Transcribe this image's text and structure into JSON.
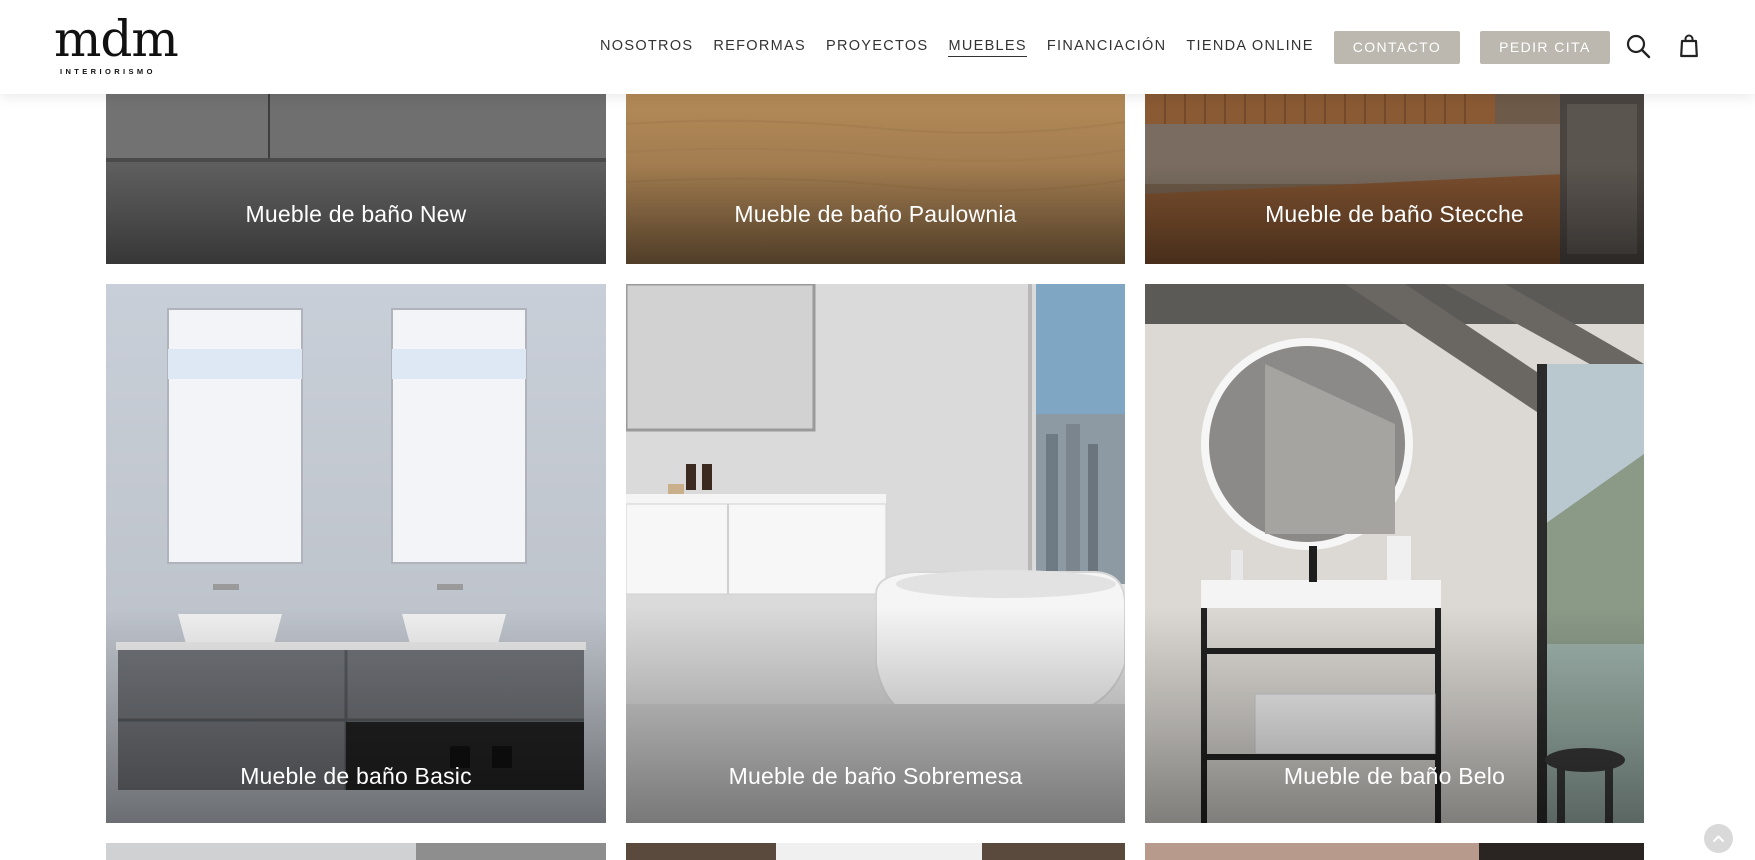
{
  "brand": {
    "name": "mdm",
    "tagline": "INTERIORISMO"
  },
  "nav": {
    "items": [
      {
        "label": "NOSOTROS",
        "active": false
      },
      {
        "label": "REFORMAS",
        "active": false
      },
      {
        "label": "PROYECTOS",
        "active": false
      },
      {
        "label": "MUEBLES",
        "active": true
      },
      {
        "label": "FINANCIACIÓN",
        "active": false
      },
      {
        "label": "TIENDA ONLINE",
        "active": false
      }
    ],
    "contact_label": "CONTACTO",
    "appointment_label": "PEDIR CITA",
    "icons": [
      "search-icon",
      "shopping-bag-icon"
    ]
  },
  "products": [
    {
      "title": "Mueble de baño New"
    },
    {
      "title": "Mueble de baño Paulownia"
    },
    {
      "title": "Mueble de baño Stecche"
    },
    {
      "title": "Mueble de baño Basic"
    },
    {
      "title": "Mueble de baño Sobremesa"
    },
    {
      "title": "Mueble de baño Belo"
    }
  ],
  "colors": {
    "button_bg": "#bcb7af",
    "text": "#333333"
  },
  "scroll_top_icon": "chevron-up-icon"
}
